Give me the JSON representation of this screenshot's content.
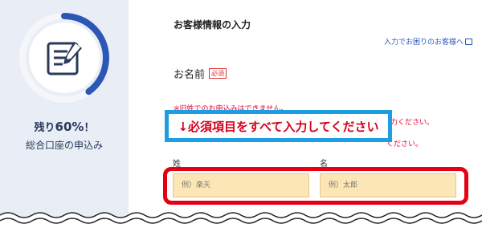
{
  "sidebar": {
    "progress_label_prefix": "残り",
    "progress_percent": "60%",
    "progress_label_suffix": "！",
    "remaining_fraction": 0.6,
    "subtitle": "総合口座の申込み",
    "icon": "edit-document-icon"
  },
  "form": {
    "section_title": "お客様情報の入力",
    "help_link": "入力でお困りのお客様へ",
    "name_label": "お名前",
    "required_badge": "必須",
    "notice_line1": "※旧姓でのお申込みはできません。",
    "notice_line2_tail": "ご入力ください。",
    "notice_line3_tail": "ください。",
    "last_name_label": "姓",
    "first_name_label": "名",
    "last_name_placeholder": "例）楽天",
    "first_name_placeholder": "例）太郎"
  },
  "callout": {
    "text": "↓必須項目をすべて入力してください"
  },
  "colors": {
    "accent_blue": "#1d9ee0",
    "highlight_red": "#e60012",
    "input_bg": "#fde6b5",
    "progress_ring": "#2c57b5"
  }
}
